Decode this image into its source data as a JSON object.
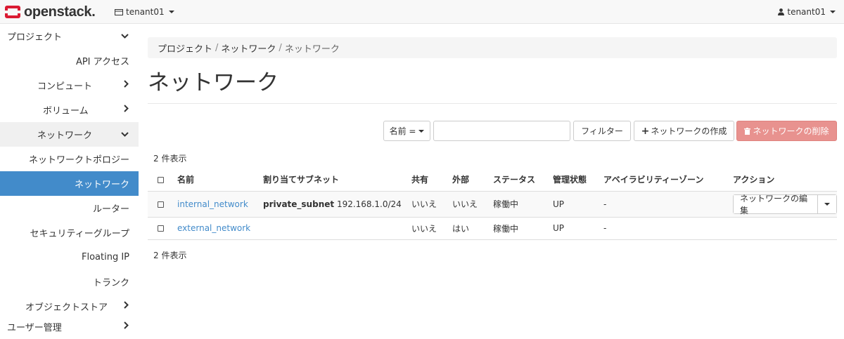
{
  "header": {
    "brand": "openstack.",
    "tenant": "tenant01",
    "user": "tenant01"
  },
  "sidebar": {
    "items": [
      {
        "label": "プロジェクト",
        "chevron": "∨"
      },
      {
        "label": "API アクセス"
      },
      {
        "label": "コンピュート",
        "chevron": "›"
      },
      {
        "label": "ボリューム",
        "chevron": "›"
      },
      {
        "label": "ネットワーク",
        "chevron": "∨"
      },
      {
        "label": "ネットワークトポロジー"
      },
      {
        "label": "ネットワーク"
      },
      {
        "label": "ルーター"
      },
      {
        "label": "セキュリティーグループ"
      },
      {
        "label": "Floating IP"
      },
      {
        "label": "トランク"
      },
      {
        "label": "オブジェクトストア",
        "chevron": "›"
      },
      {
        "label": "ユーザー管理",
        "chevron": "›"
      }
    ]
  },
  "breadcrumb": {
    "items": [
      "プロジェクト",
      "ネットワーク",
      "ネットワーク"
    ],
    "separator": "/"
  },
  "page": {
    "title": "ネットワーク"
  },
  "toolbar": {
    "filter_field": "名前 =",
    "search_value": "",
    "filter_button": "フィルター",
    "create_button": "ネットワークの作成",
    "delete_button": "ネットワークの削除"
  },
  "table": {
    "count_top": "2 件表示",
    "count_bottom": "2 件表示",
    "headers": [
      "名前",
      "割り当てサブネット",
      "共有",
      "外部",
      "ステータス",
      "管理状態",
      "アベイラビリティーゾーン",
      "アクション"
    ],
    "rows": [
      {
        "name": "internal_network",
        "subnet_name": "private_subnet",
        "subnet_cidr": "192.168.1.0/24",
        "shared": "いいえ",
        "external": "いいえ",
        "status": "稼働中",
        "admin_state": "UP",
        "az": "-",
        "action": "ネットワークの編集"
      },
      {
        "name": "external_network",
        "subnet_name": "",
        "subnet_cidr": "",
        "shared": "いいえ",
        "external": "はい",
        "status": "稼働中",
        "admin_state": "UP",
        "az": "-",
        "action": ""
      }
    ]
  },
  "colors": {
    "accent": "#428bca",
    "danger": "#e8928f",
    "logo_red": "#da1a32"
  }
}
